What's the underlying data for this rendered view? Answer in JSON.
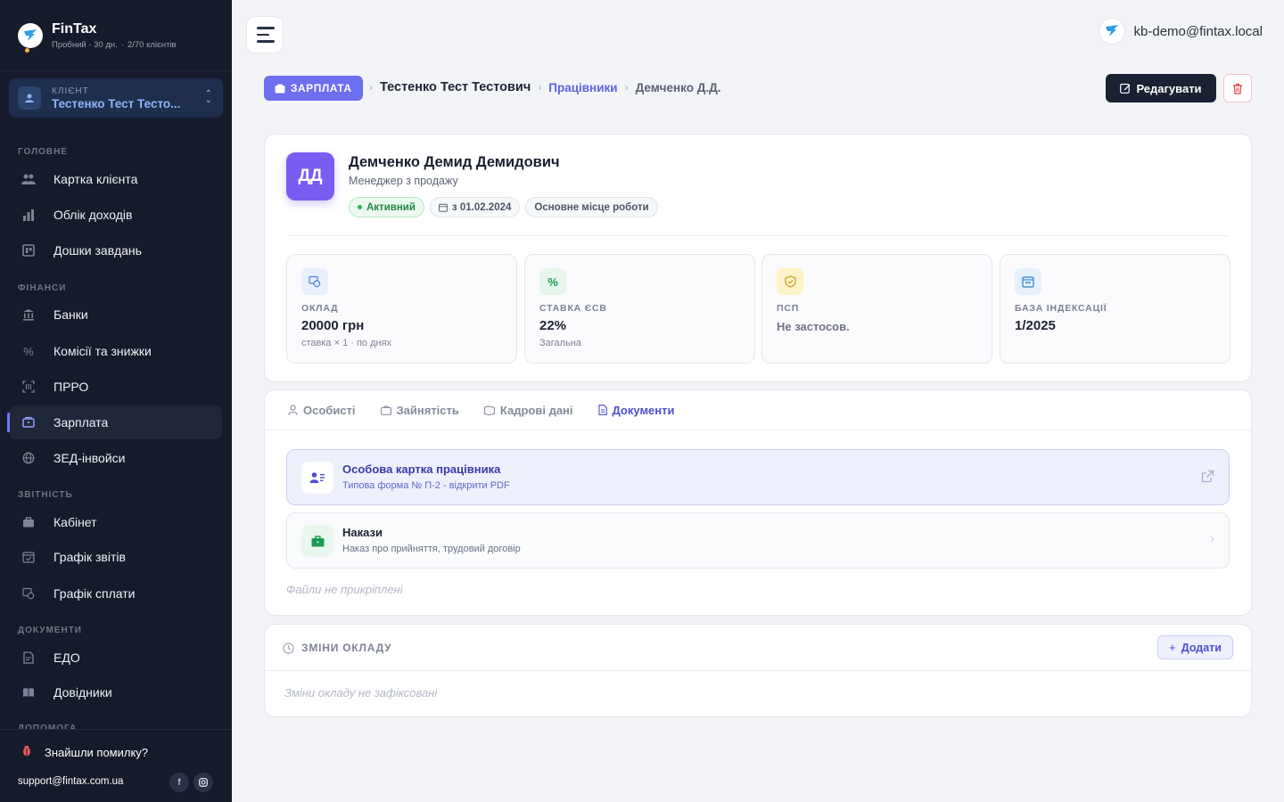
{
  "brand": {
    "name": "FinTax",
    "trial": "Пробний - 30 дн.",
    "clients": "2/70 клієнтів"
  },
  "client": {
    "label": "КЛІЄНТ",
    "name": "Тестенко Тест Тесто..."
  },
  "sidebar": {
    "sections": {
      "main": "ГОЛОВНЕ",
      "finance": "ФІНАНСИ",
      "reports": "ЗВІТНІСТЬ",
      "documents": "ДОКУМЕНТИ",
      "help": "ДОПОМОГА"
    },
    "items": [
      {
        "label": "Картка клієнта",
        "icon": "users-icon"
      },
      {
        "label": "Облік доходів",
        "icon": "bar-chart-icon"
      },
      {
        "label": "Дошки завдань",
        "icon": "board-icon"
      },
      {
        "label": "Банки",
        "icon": "bank-icon"
      },
      {
        "label": "Комісії та знижки",
        "icon": "percent-icon"
      },
      {
        "label": "ПРРО",
        "icon": "barcode-icon"
      },
      {
        "label": "Зарплата",
        "icon": "wallet-icon",
        "active": true
      },
      {
        "label": "ЗЕД-інвойси",
        "icon": "globe-icon"
      },
      {
        "label": "Кабінет",
        "icon": "briefcase-icon"
      },
      {
        "label": "Графік звітів",
        "icon": "calendar-check-icon"
      },
      {
        "label": "Графік сплати",
        "icon": "payment-icon"
      },
      {
        "label": "ЕДО",
        "icon": "document-edit-icon"
      },
      {
        "label": "Довідники",
        "icon": "book-icon"
      }
    ],
    "bug": "Знайшли помилку?",
    "support": "support@fintax.com.ua"
  },
  "user": {
    "email": "kb-demo@fintax.local"
  },
  "breadcrumb": {
    "section": "ЗАРПЛАТА",
    "client": "Тестенко Тест Тестович",
    "list": "Працівники",
    "current": "Демченко Д.Д."
  },
  "actions": {
    "edit": "Редагувати"
  },
  "employee": {
    "initials": "ДД",
    "name": "Демченко Демид Демидович",
    "role": "Менеджер з продажу",
    "status": "Активний",
    "since": "з 01.02.2024",
    "workplace": "Основне місце роботи"
  },
  "stats": [
    {
      "label": "ОКЛАД",
      "value": "20000 грн",
      "sub": "ставка × 1 · по днях",
      "color": "#4a7be0"
    },
    {
      "label": "СТАВКА ЄСВ",
      "value": "22%",
      "sub": "Загальна",
      "color": "#1e9a52"
    },
    {
      "label": "ПСП",
      "value": "Не застосов.",
      "sub": "",
      "color": "#c99a12"
    },
    {
      "label": "БАЗА ІНДЕКСАЦІЇ",
      "value": "1/2025",
      "sub": "",
      "color": "#2f7fd0"
    }
  ],
  "tabs": [
    {
      "label": "Особисті",
      "icon": "person-icon"
    },
    {
      "label": "Зайнятість",
      "icon": "briefcase-icon"
    },
    {
      "label": "Кадрові дані",
      "icon": "folder-icon"
    },
    {
      "label": "Документи",
      "icon": "document-icon",
      "active": true
    }
  ],
  "documents": [
    {
      "title": "Особова картка працівника",
      "sub": "Типова форма № П-2 - відкрити PDF"
    },
    {
      "title": "Накази",
      "sub": "Наказ про прийняття, трудовий договір"
    }
  ],
  "docs_empty": "Файли не прикріплені",
  "changes": {
    "title": "ЗМІНИ ОКЛАДУ",
    "add": "Додати",
    "empty": "Зміни окладу не зафіксовані"
  }
}
